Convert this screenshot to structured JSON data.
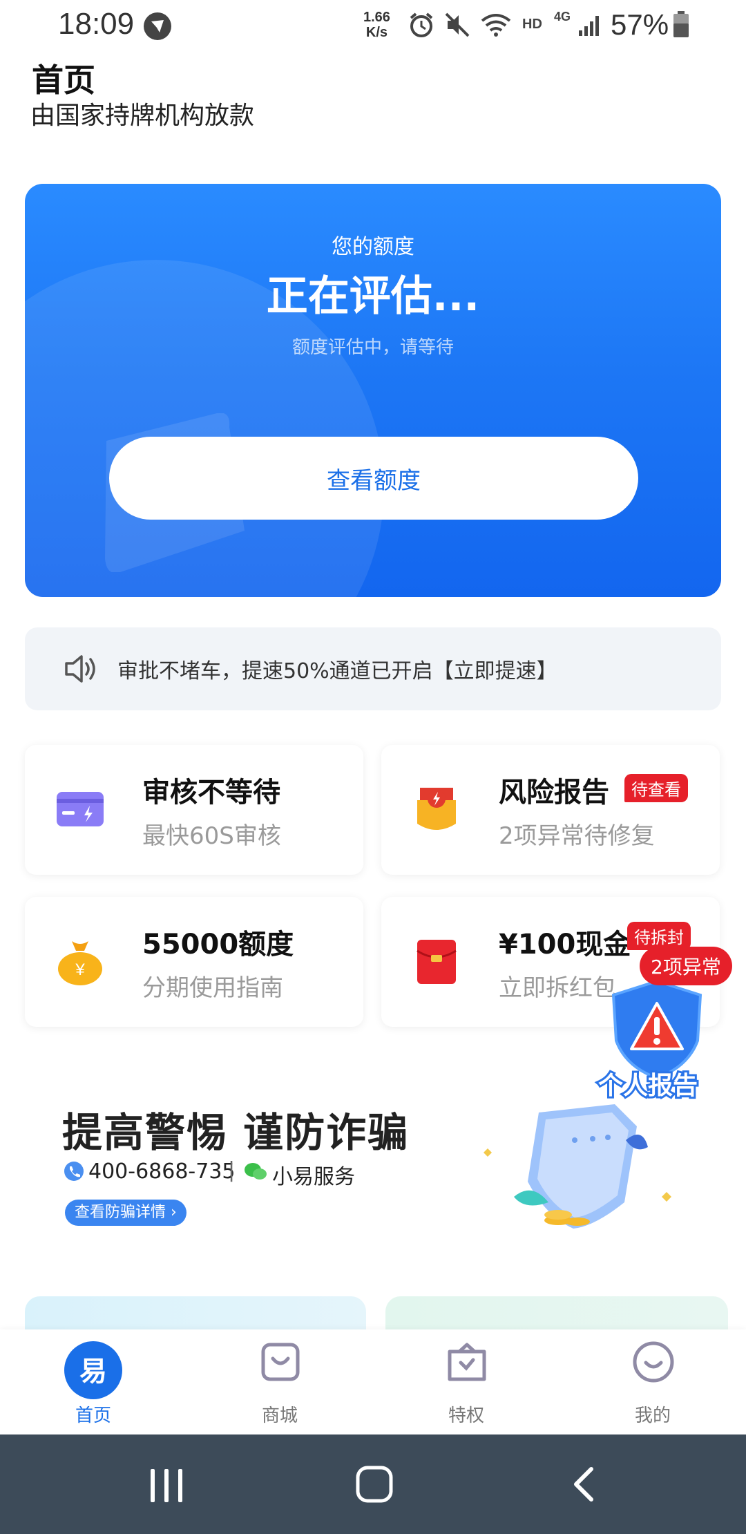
{
  "status_bar": {
    "time": "18:09",
    "net_speed_value": "1.66",
    "net_speed_unit": "K/s",
    "hd": "HD",
    "network": "4G",
    "battery": "57%"
  },
  "header": {
    "title": "首页",
    "subtitle": "由国家持牌机构放款"
  },
  "hero": {
    "label": "您的额度",
    "status": "正在评估...",
    "hint": "额度评估中，请等待",
    "button": "查看额度"
  },
  "notice": {
    "text": "审批不堵车，提速50%通道已开启【立即提速】"
  },
  "features": [
    {
      "title": "审核不等待",
      "subtitle": "最快60S审核",
      "icon": "card-icon",
      "badge": ""
    },
    {
      "title": "风险报告",
      "subtitle": "2项异常待修复",
      "icon": "risk-report-icon",
      "badge": "待查看"
    },
    {
      "title": "55000额度",
      "subtitle": "分期使用指南",
      "icon": "money-bag-icon",
      "badge": ""
    },
    {
      "title": "¥100现金",
      "subtitle": "立即拆红包",
      "icon": "red-envelope-icon",
      "badge": "待拆封"
    }
  ],
  "float_report": {
    "badge": "2项异常",
    "label": "个人报告"
  },
  "anti_fraud": {
    "title": "提高警惕 谨防诈骗",
    "phone": "400-6868-735",
    "separator": "|",
    "service": "小易服务",
    "link": "查看防骗详情"
  },
  "bottom_nav": [
    {
      "label": "首页",
      "active": true
    },
    {
      "label": "商城",
      "active": false
    },
    {
      "label": "特权",
      "active": false
    },
    {
      "label": "我的",
      "active": false
    }
  ],
  "colors": {
    "primary": "#1a6fe8",
    "badge_red": "#e6202a"
  }
}
